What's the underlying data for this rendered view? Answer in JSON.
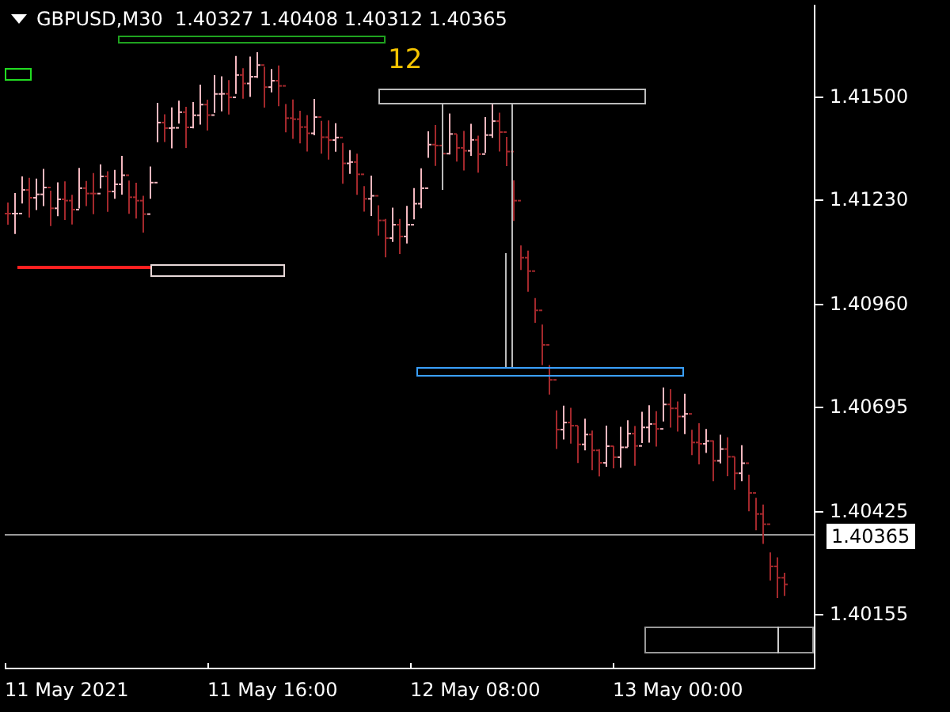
{
  "chart_header": {
    "text": "GBPUSD,M30  1.40327 1.40408 1.40312 1.40365"
  },
  "bar_count_label": "12",
  "price_axis": {
    "labels": [
      "1.41500",
      "1.41230",
      "1.40960",
      "1.40695",
      "1.40425",
      "1.40155"
    ],
    "current_price": "1.40365"
  },
  "time_axis": {
    "labels": [
      "11 May 2021",
      "11 May 16:00",
      "12 May 08:00",
      "13 May 00:00"
    ]
  }
}
